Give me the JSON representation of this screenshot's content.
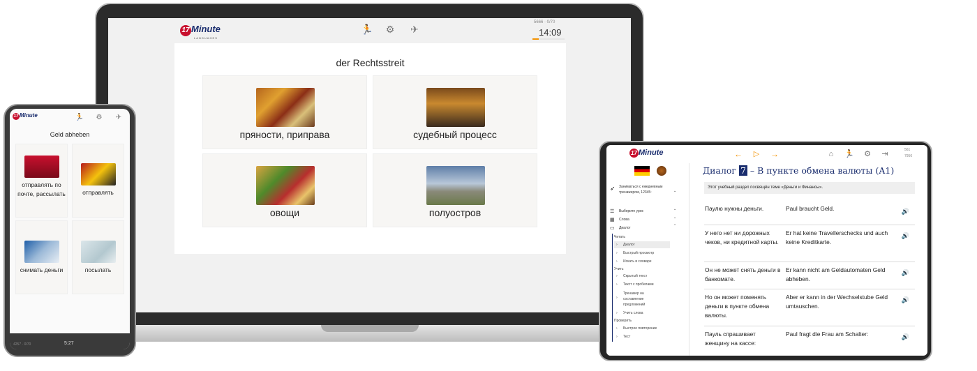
{
  "brand": {
    "logo_number": "17",
    "logo_word": "Minute",
    "logo_sub": "LANGUAGES"
  },
  "colors": {
    "brand_red": "#c8102e",
    "brand_navy": "#1a2d6e",
    "accent_orange": "#f39200"
  },
  "laptop": {
    "stats": "5666 · 0/70",
    "timer": "14:09",
    "icons": [
      "run-icon",
      "gear-icon",
      "plane-off-icon"
    ],
    "quiz_word": "der Rechtsstreit",
    "options": [
      {
        "label": "пряности, приправа",
        "image": "spices"
      },
      {
        "label": "судебный процесс",
        "image": "courtroom"
      },
      {
        "label": "овощи",
        "image": "vegetables"
      },
      {
        "label": "полуостров",
        "image": "peninsula"
      }
    ]
  },
  "phone": {
    "quiz_word": "Geld abheben",
    "options": [
      {
        "label": "отправлять по почте, рассылать",
        "image": "mailbox"
      },
      {
        "label": "отправлять",
        "image": "person-phone"
      },
      {
        "label": "снимать деньги",
        "image": "atm-card"
      },
      {
        "label": "посылать",
        "image": "send"
      }
    ],
    "stats": "4257 · 0/70",
    "timer": "5:27"
  },
  "tablet": {
    "stats_top": "561",
    "stats_bottom": "7956",
    "dialog_title_prefix": "Диалог",
    "dialog_number": "7",
    "dialog_title_suffix": "– В пункте обмена валюты (A1)",
    "intro": "Этот учебный раздел посвящён теме «Деньги и Финансы».",
    "trainer_text": "Заниматься с ежедневным тренажером, 12345:",
    "menu": [
      {
        "label": "Выберите урок",
        "icon": "list-icon"
      },
      {
        "label": "Слова",
        "icon": "words-icon"
      },
      {
        "label": "Диалог",
        "icon": "dialog-icon"
      }
    ],
    "sections": [
      {
        "heading": "Читать",
        "items": [
          "Диалог",
          "Быстрый просмотр",
          "Искать в словаре"
        ]
      },
      {
        "heading": "Учить",
        "items": [
          "Скрытый текст",
          "Текст с пробелами",
          "Тренажер на составление предложений",
          "Учить слова"
        ]
      },
      {
        "heading": "Проверить",
        "items": [
          "Быстрое повторение",
          "Тест"
        ]
      }
    ],
    "dialog": [
      {
        "ru": "Паулю нужны деньги.",
        "de": "Paul braucht Geld."
      },
      {
        "ru": "У него нет ни дорожных чеков, ни кредитной карты.",
        "de": "Er hat keine Travellerschecks und auch keine Kreditkarte."
      },
      {
        "ru": "Он не может снять деньги в банкомате.",
        "de": "Er kann nicht am Geldautomaten Geld abheben."
      },
      {
        "ru": "Но он может поменять деньги в пункте обмена валюты.",
        "de": "Aber er kann in der Wechselstube Geld umtauschen."
      },
      {
        "ru": "Пауль спрашивает женщину на кассе:",
        "de": "Paul fragt die Frau am Schalter:"
      }
    ]
  }
}
